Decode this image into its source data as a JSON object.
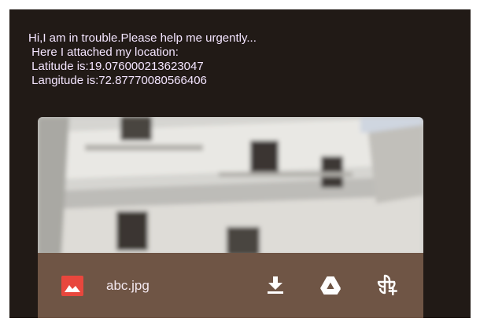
{
  "message": {
    "lines": [
      "Hi,I am in trouble.Please help me urgently...",
      " Here I attached my location:",
      " Latitude is:19.076000213623047",
      " Langitude is:72.87770080566406"
    ]
  },
  "attachment": {
    "file_name": "abc.jpg",
    "file_type_icon": "image-icon",
    "actions": [
      {
        "name": "download",
        "icon": "download-icon"
      },
      {
        "name": "save-to-drive",
        "icon": "drive-icon"
      },
      {
        "name": "add-to-photos",
        "icon": "photos-add-icon"
      }
    ]
  },
  "colors": {
    "background": "#211a16",
    "message_text": "#f4e5ff",
    "attachment_bar": "#6f5545",
    "image_icon": "#e8473d",
    "action_icon": "#ffffff"
  }
}
